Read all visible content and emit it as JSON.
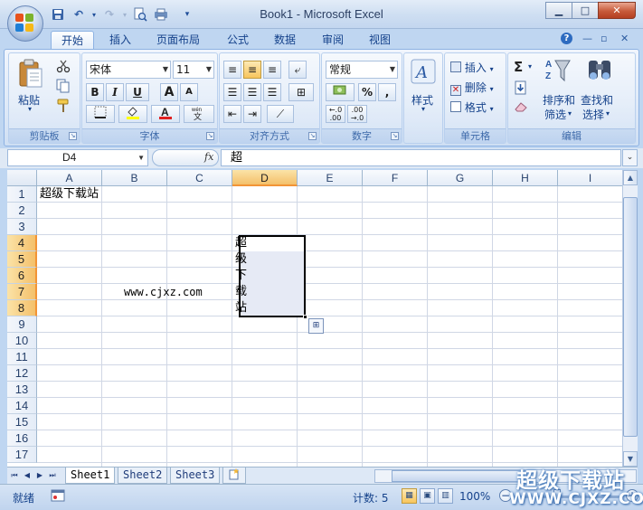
{
  "window": {
    "title": "Book1 - Microsoft Excel",
    "minimize": "▁",
    "restore": "□",
    "close": "✕"
  },
  "qat": {
    "save": "💾",
    "undo": "↶",
    "redo": "↷",
    "print_preview": "🔍",
    "more": "▾"
  },
  "ribbon_tabs": [
    "开始",
    "插入",
    "页面布局",
    "公式",
    "数据",
    "审阅",
    "视图"
  ],
  "ribbon_right": {
    "help": "?",
    "min": "—",
    "restore": "▫",
    "close": "✕"
  },
  "clipboard": {
    "paste": "粘贴",
    "label": "剪贴板"
  },
  "font": {
    "name": "宋体",
    "size": "11",
    "bold": "B",
    "italic": "I",
    "underline": "U",
    "grow": "A",
    "shrink": "A",
    "label": "字体",
    "color_red": "#e02020",
    "highlight_yellow": "#ffff00"
  },
  "alignment": {
    "label": "对齐方式"
  },
  "number": {
    "format": "常规",
    "percent": "%",
    "comma": ",",
    "label": "数字",
    "inc_dec": ".0\n.00"
  },
  "styles": {
    "label": "样式"
  },
  "cells": {
    "insert": "插入",
    "delete": "删除",
    "format": "格式",
    "label": "单元格"
  },
  "editing": {
    "sort": "排序和\n筛选",
    "sort_l1": "排序和",
    "sort_l2": "筛选",
    "find_l1": "查找和",
    "find_l2": "选择",
    "sigma": "Σ",
    "label": "编辑"
  },
  "formula_bar": {
    "name_box": "D4",
    "fx": "fx",
    "value": "超"
  },
  "columns": [
    "A",
    "B",
    "C",
    "D",
    "E",
    "F",
    "G",
    "H",
    "I"
  ],
  "rows": [
    "1",
    "2",
    "3",
    "4",
    "5",
    "6",
    "7",
    "8",
    "9",
    "10",
    "11",
    "12",
    "13",
    "14",
    "15",
    "16",
    "17"
  ],
  "selected_column": "D",
  "selected_rows": [
    "4",
    "5",
    "6",
    "7",
    "8"
  ],
  "cells_data": {
    "A1": "超级下载站",
    "B7": "www.cjxz.com",
    "D4": "超",
    "D5": "级",
    "D6": "下",
    "D7": "载",
    "D8": "站"
  },
  "sheets": [
    "Sheet1",
    "Sheet2",
    "Sheet3"
  ],
  "active_sheet": "Sheet1",
  "status": {
    "mode": "就绪",
    "count": "计数: 5",
    "zoom": "100%"
  },
  "watermark": {
    "line1": "超级下载站",
    "line2": "WWW.CJXZ.COM"
  }
}
